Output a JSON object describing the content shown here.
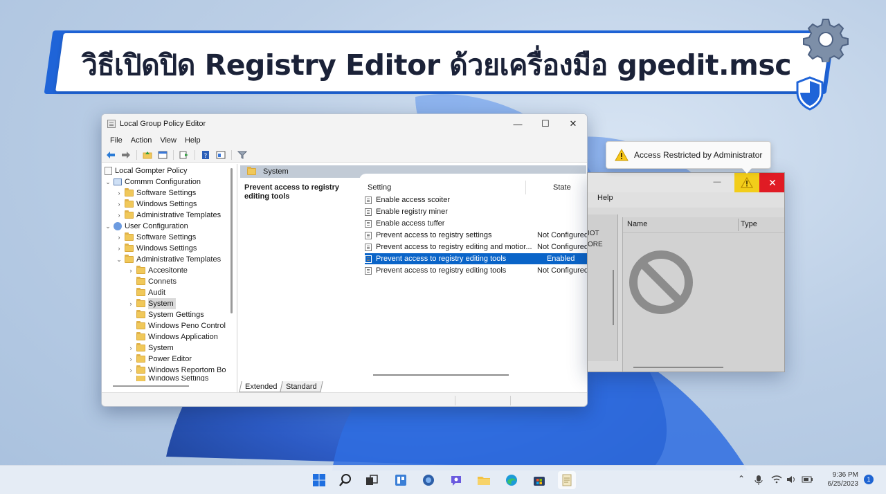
{
  "banner": {
    "title": "วิธีเปิดปิด Registry Editor ด้วยเครื่องมือ gpedit.msc"
  },
  "gpedit": {
    "title": "Local Group Policy Editor",
    "window_controls": {
      "minimize": "—",
      "maximize": "☐",
      "close": "✕"
    },
    "menu": [
      "File",
      "Action",
      "View",
      "Help"
    ],
    "tree": [
      {
        "label": "Local Gompter Policy"
      },
      {
        "label": "Commm Configuration"
      },
      {
        "label": "Software Settings"
      },
      {
        "label": "Windows Settings"
      },
      {
        "label": "Administrative Templates"
      },
      {
        "label": "User Configuration"
      },
      {
        "label": "Software Settings"
      },
      {
        "label": "Windows Settings"
      },
      {
        "label": "Administrative Templates"
      },
      {
        "label": "Accesitonte"
      },
      {
        "label": "Connets"
      },
      {
        "label": "Audit"
      },
      {
        "label": "System"
      },
      {
        "label": "System Gettings"
      },
      {
        "label": "Windows Peno Control"
      },
      {
        "label": "Windows Application"
      },
      {
        "label": "System"
      },
      {
        "label": "Power Editor"
      },
      {
        "label": "Windows Reportom Bo"
      },
      {
        "label": "Windows Settings"
      }
    ],
    "breadcrumb": "System",
    "description_title": "Prevent access to registry editing tools",
    "columns": {
      "setting": "Setting",
      "state": "State"
    },
    "rows": [
      {
        "name": "Enable access scoiter",
        "state": ""
      },
      {
        "name": "Enable registry miner",
        "state": ""
      },
      {
        "name": "Enable access tuffer",
        "state": ""
      },
      {
        "name": "Prevent access to registry settings",
        "state": "Not Configured"
      },
      {
        "name": "Prevent access to registry editing and motior...",
        "state": "Not Configured"
      },
      {
        "name": "Prevent access to registry editing tools",
        "state": "Enabled"
      },
      {
        "name": "Prevent access to registry editing tools",
        "state": "Not Configured"
      }
    ],
    "selected_row": 5,
    "tabs": [
      "Extended",
      "Standard"
    ],
    "active_tab": "Extended"
  },
  "registry_window": {
    "menu_help": "Help",
    "left_fragments": [
      "IOT",
      "ORE"
    ],
    "columns": {
      "name": "Name",
      "type": "Type"
    },
    "close": "✕",
    "minimize": "—"
  },
  "tooltip": {
    "text": "Access Restricted by Administrator"
  },
  "taskbar": {
    "apps": [
      "start-icon",
      "search-icon",
      "task-view-icon",
      "widgets-icon",
      "media-icon",
      "chat-icon",
      "file-explorer-icon",
      "edge-icon",
      "store-icon",
      "notepad-icon"
    ],
    "time": "9:36 PM",
    "date": "6/25/2023",
    "notifications": "1"
  },
  "colors": {
    "banner_accent": "#1f64d8",
    "selection": "#0a64c8",
    "warning": "#f2cd1a",
    "close_red": "#e01b24"
  }
}
